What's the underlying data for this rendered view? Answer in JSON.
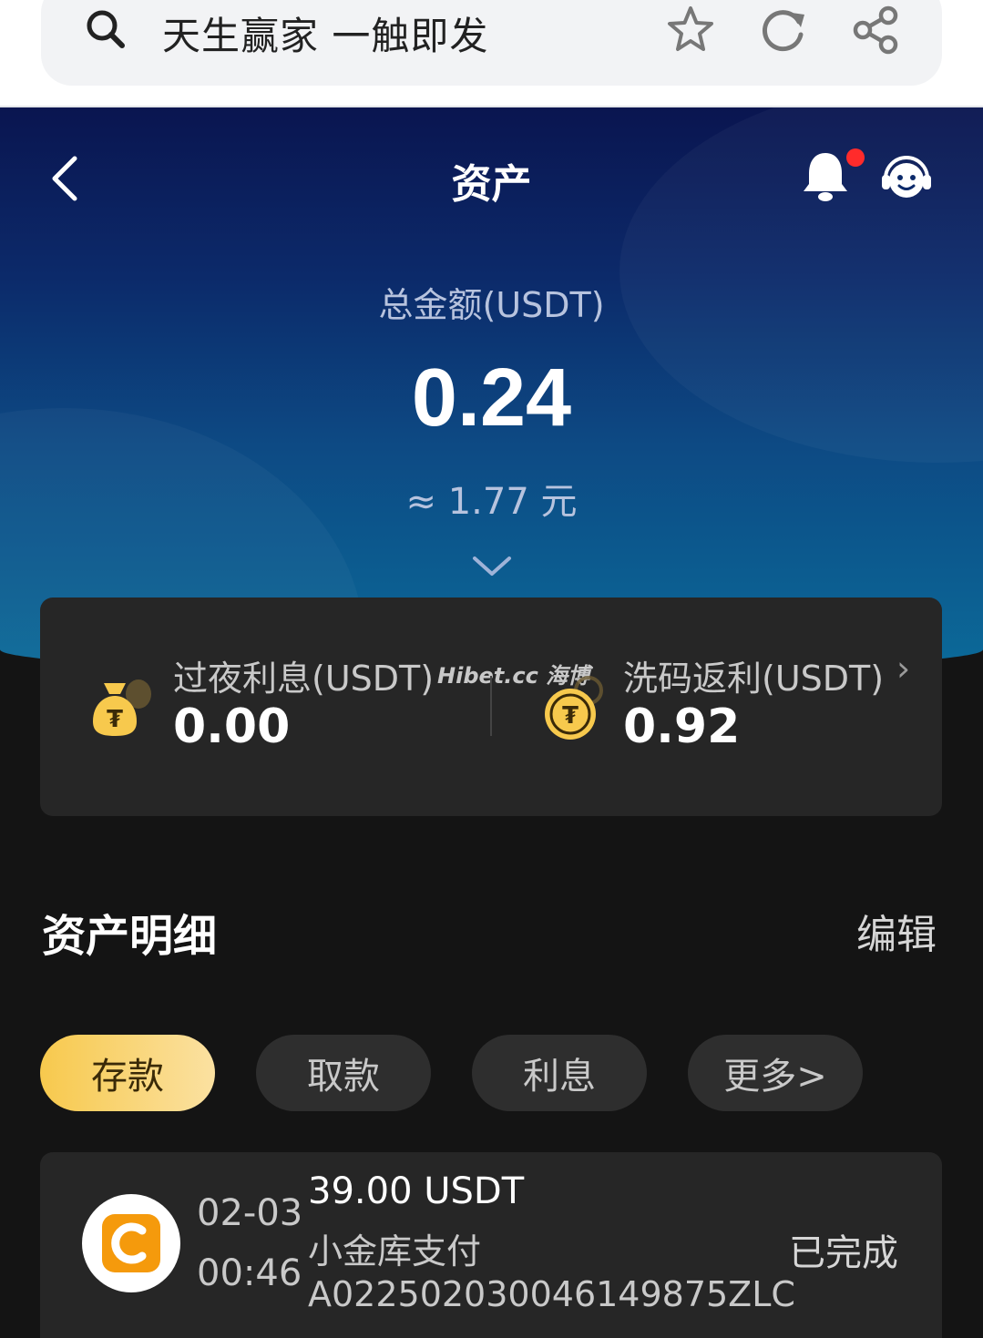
{
  "browser": {
    "url_text": "天生赢家 一触即发"
  },
  "header": {
    "title": "资产"
  },
  "summary": {
    "total_label": "总金额(USDT)",
    "total_value": "0.24",
    "approx_value": "≈ 1.77 元"
  },
  "balances": {
    "overnight_label": "过夜利息(USDT)",
    "overnight_value": "0.00",
    "rebate_label": "洗码返利(USDT)",
    "rebate_value": "0.92",
    "chevron": "›",
    "watermark": "Hibet.cc 海博"
  },
  "details": {
    "title": "资产明细",
    "edit_label": "编辑"
  },
  "tabs": [
    {
      "label": "存款",
      "active": true
    },
    {
      "label": "取款",
      "active": false
    },
    {
      "label": "利息",
      "active": false
    },
    {
      "label": "更多>",
      "active": false
    }
  ],
  "transactions": [
    {
      "date": "02-03",
      "time": "00:46",
      "amount": "39.00 USDT",
      "method": "小金库支付",
      "id": "A022502030046149875ZLC",
      "status": "已完成"
    }
  ],
  "colors": {
    "accent_gold": "#f7c94d",
    "card_bg": "#262626",
    "page_bg": "#141414",
    "notification_dot": "#ff2b2b"
  }
}
